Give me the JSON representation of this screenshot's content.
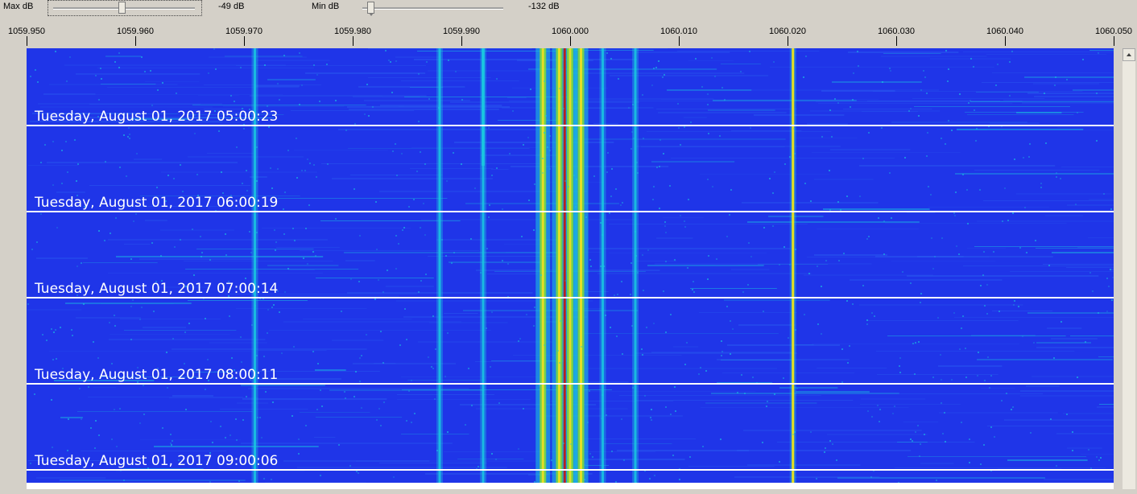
{
  "controls": {
    "max_db_label": "Max dB",
    "max_db_value": "-49 dB",
    "max_db_slider_level": 0.48,
    "min_db_label": "Min dB",
    "min_db_value": "-132 dB",
    "min_db_slider_level": 0.05
  },
  "frequency_axis": {
    "ticks": [
      "1059.950",
      "1059.960",
      "1059.970",
      "1059.980",
      "1059.990",
      "1060.000",
      "1060.010",
      "1060.020",
      "1060.030",
      "1060.040",
      "1060.050"
    ]
  },
  "waterfall": {
    "timestamps": [
      "Tuesday, August 01, 2017 05:00:23",
      "Tuesday, August 01, 2017 06:00:19",
      "Tuesday, August 01, 2017 07:00:14",
      "Tuesday, August 01, 2017 08:00:11",
      "Tuesday, August 01, 2017 09:00:06"
    ],
    "colors": {
      "background": "#1f35e8",
      "noise": "#2a5cf0",
      "cyan": "#19c8e0",
      "green": "#7ddc3a",
      "yellow": "#f0e020",
      "red": "#c81010"
    },
    "signals_mhz": [
      1059.971,
      1059.988,
      1059.992,
      1059.9975,
      1059.999,
      1060.0,
      1060.001,
      1060.003,
      1060.006,
      1060.0205
    ]
  }
}
